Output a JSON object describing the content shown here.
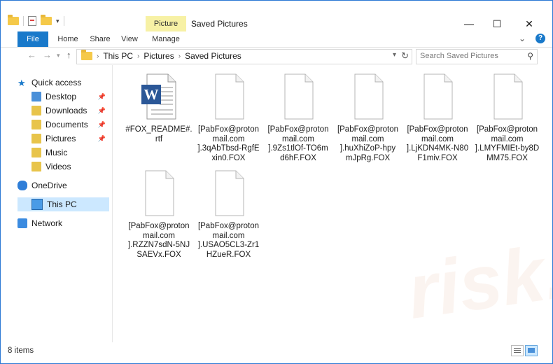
{
  "window": {
    "title": "Saved Pictures",
    "contextual_tab": "Picture Tools",
    "controls": {
      "minimize": "—",
      "maximize": "☐",
      "close": "✕"
    }
  },
  "ribbon": {
    "tabs": [
      "File",
      "Home",
      "Share",
      "View",
      "Manage"
    ],
    "expand_glyph": "⌄"
  },
  "address": {
    "crumbs": [
      "This PC",
      "Pictures",
      "Saved Pictures"
    ],
    "search_placeholder": "Search Saved Pictures"
  },
  "navigation": {
    "items": [
      {
        "label": "Quick access",
        "icon": "star-icon"
      },
      {
        "label": "Desktop",
        "icon": "folder-blue-icon",
        "pinned": true
      },
      {
        "label": "Downloads",
        "icon": "download-folder-icon",
        "pinned": true
      },
      {
        "label": "Documents",
        "icon": "documents-folder-icon",
        "pinned": true
      },
      {
        "label": "Pictures",
        "icon": "pictures-folder-icon",
        "pinned": true
      },
      {
        "label": "Music",
        "icon": "music-folder-icon"
      },
      {
        "label": "Videos",
        "icon": "videos-folder-icon"
      },
      {
        "label": "OneDrive",
        "icon": "cloud-icon"
      },
      {
        "label": "This PC",
        "icon": "computer-icon",
        "selected": true
      },
      {
        "label": "Network",
        "icon": "network-icon"
      }
    ]
  },
  "files": [
    {
      "lines": [
        "#FOX_README#.",
        "rtf"
      ],
      "type": "word"
    },
    {
      "lines": [
        "[PabFox@proton",
        "mail.com",
        "].3qAbTbsd-RgfE",
        "xin0.FOX"
      ],
      "type": "blank"
    },
    {
      "lines": [
        "[PabFox@proton",
        "mail.com",
        "].9Zs1tlOf-TO6m",
        "d6hF.FOX"
      ],
      "type": "blank"
    },
    {
      "lines": [
        "[PabFox@proton",
        "mail.com",
        "].huXhiZoP-hpy",
        "mJpRg.FOX"
      ],
      "type": "blank"
    },
    {
      "lines": [
        "[PabFox@proton",
        "mail.com",
        "].LjKDN4MK-N80",
        "F1miv.FOX"
      ],
      "type": "blank"
    },
    {
      "lines": [
        "[PabFox@proton",
        "mail.com",
        "].LMYFMIEt-by8D",
        "MM75.FOX"
      ],
      "type": "blank"
    },
    {
      "lines": [
        "[PabFox@proton",
        "mail.com",
        "].RZZN7sdN-5NJ",
        "SAEVx.FOX"
      ],
      "type": "blank"
    },
    {
      "lines": [
        "[PabFox@proton",
        "mail.com",
        "].USAO5CL3-Zr1",
        "HZueR.FOX"
      ],
      "type": "blank"
    }
  ],
  "status": {
    "count": "8 items"
  },
  "colors": {
    "accent": "#1979ca",
    "selected": "#cce8ff",
    "picture_tools": "#f7f1a5"
  }
}
